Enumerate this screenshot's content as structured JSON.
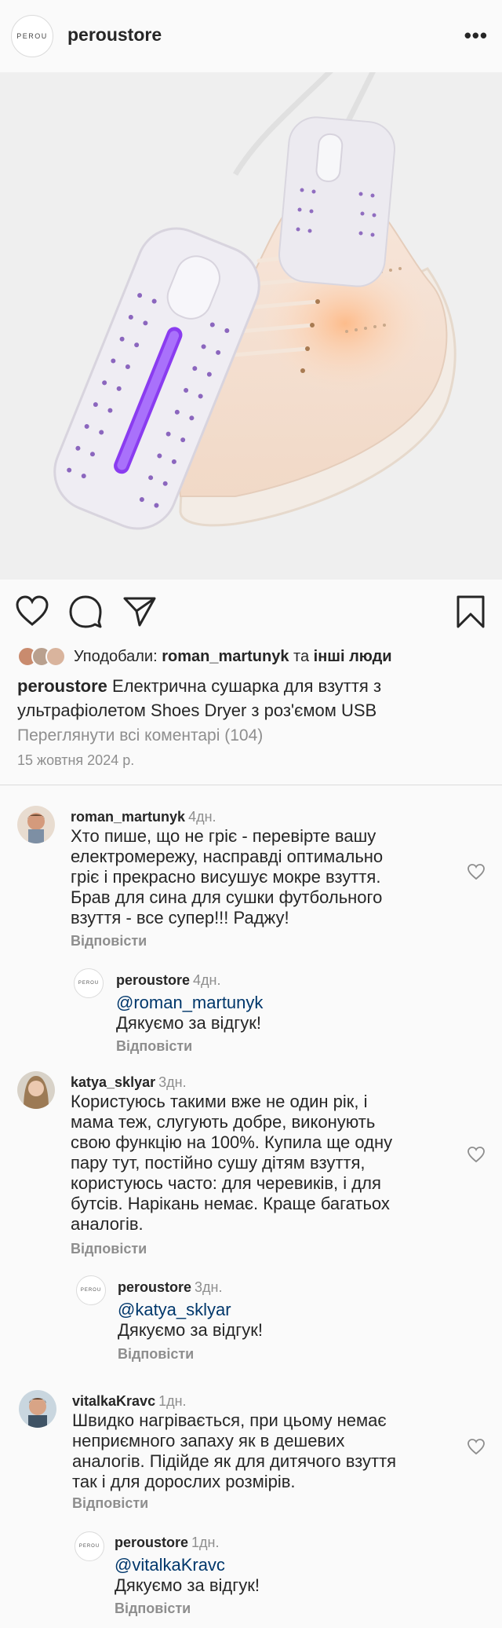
{
  "header": {
    "logo_text": "PEROU",
    "username": "peroustore",
    "more_label": "•••"
  },
  "post": {
    "likes_prefix": "Уподобали:",
    "likes_user": "roman_martunyk",
    "likes_and": "та",
    "likes_others": "інші люди",
    "caption_user": "peroustore",
    "caption_text": "Електрична сушарка для взуття з ультрафіолетом Shoes Dryer з роз'ємом USB",
    "view_all": "Переглянути всі коментарі (104)",
    "date": "15 жовтня 2024 р."
  },
  "comments": [
    {
      "user": "roman_martunyk",
      "time": "4дн.",
      "lines": [
        "Хто пише, що не гріє - перевірте вашу",
        "електромережу, насправді оптимально",
        "гріє і прекрасно висушує мокре взуття.",
        "Брав для сина для сушки футбольного",
        "взуття - все супер!!! Раджу!"
      ],
      "reply_label": "Відповісти",
      "answer": {
        "user": "peroustore",
        "time": "4дн.",
        "mention": "@roman_martunyk",
        "text": "Дякуємо за відгук!",
        "reply_label": "Відповісти",
        "logo_text": "PEROU"
      }
    },
    {
      "user": "katya_sklyar",
      "time": "3дн.",
      "lines": [
        "Користуюсь такими вже не один рік, і",
        "мама теж, слугують добре, виконують",
        "свою функцію на 100%. Купила ще одну",
        "пару тут, постійно сушу дітям взуття,",
        "користуюсь часто: для черевиків, і для",
        "бутсів. Нарікань немає. Краще багатьох",
        "аналогів."
      ],
      "reply_label": "Відповісти",
      "answer": {
        "user": "peroustore",
        "time": "3дн.",
        "mention": "@katya_sklyar",
        "text": "Дякуємо за відгук!",
        "reply_label": "Відповісти",
        "logo_text": "PEROU"
      }
    },
    {
      "user": "vitalkaKravc",
      "time": "1дн.",
      "lines": [
        "Швидко нагрівається, при цьому немає",
        "неприємного запаху як в дешевих",
        "аналогів. Підійде як для дитячого взуття",
        "так і для дорослих розмірів."
      ],
      "reply_label": "Відповісти",
      "answer": {
        "user": "peroustore",
        "time": "1дн.",
        "mention": "@vitalkaKravc",
        "text": "Дякуємо за відгук!",
        "reply_label": "Відповісти",
        "logo_text": "PEROU"
      }
    }
  ],
  "colors": {
    "background": "#fafafa",
    "text": "#262626",
    "muted": "#8e8e8e",
    "mention": "#00376b",
    "uv_purple": "#8a3cf0"
  },
  "icons": [
    "heart-icon",
    "comment-icon",
    "share-icon",
    "bookmark-icon",
    "like-comment-icon"
  ]
}
